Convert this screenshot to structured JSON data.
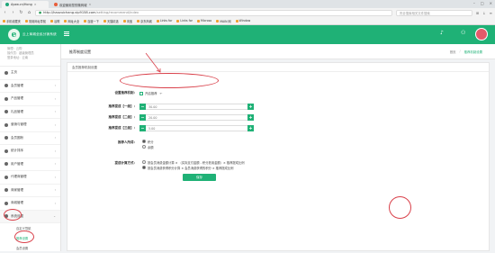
{
  "browser": {
    "tabs": [
      {
        "title": "Ayaw.cn/Hong",
        "active": true
      },
      {
        "title": "欢迎使用您的微商城",
        "active": false
      }
    ],
    "url_host": "http://haozuichang.vip9158.com",
    "url_path": "/setting/recommend/index",
    "search_placeholder": "完全搜索相关文件搜索",
    "bookmarks": [
      "手机收藏夹",
      "常用网址导航",
      "谷歌",
      "网址大全",
      "百度一下",
      "天猫精选",
      "淘宝",
      "京东商城",
      "Links for",
      "Links for",
      "Microso",
      "MAIN 网",
      "Window"
    ]
  },
  "app": {
    "brand": "云上商城全民分销系统",
    "logo_letter": "e"
  },
  "sidebar": {
    "info": [
      "管理：云购",
      "操作员：超级管理员",
      "登录地址：云南"
    ],
    "items": [
      {
        "label": "主页",
        "chevron": ""
      },
      {
        "label": "会员管理",
        "chevron": "‹"
      },
      {
        "label": "产品管理",
        "chevron": "‹"
      },
      {
        "label": "礼品管理",
        "chevron": "‹"
      },
      {
        "label": "营销与管理",
        "chevron": "‹"
      },
      {
        "label": "会员圈粉",
        "chevron": "‹"
      },
      {
        "label": "统计排序",
        "chevron": "‹"
      },
      {
        "label": "用户管理",
        "chevron": "‹"
      },
      {
        "label": "代理商管理",
        "chevron": "‹"
      },
      {
        "label": "商家管理",
        "chevron": "‹"
      },
      {
        "label": "商城管理",
        "chevron": "‹"
      },
      {
        "label": "系统设置",
        "chevron": "⌄"
      }
    ],
    "subitems": [
      "自定义导航",
      "推荐设置",
      "会员设置"
    ]
  },
  "page": {
    "title": "推荐制度设置",
    "crumbs": [
      "首页",
      "推荐机制设置"
    ],
    "panel_title": "会员推荐机制设置"
  },
  "form": {
    "switch_label": "设置推荐机制：",
    "switch_option": "开启推荐",
    "level1_label": "推荐提成【一级】：",
    "level1_value": "30.00",
    "level2_label": "推荐提成【二级】：",
    "level2_value": "20.00",
    "level3_label": "推荐提成【三级】：",
    "level3_value": "5.00",
    "minus": "−",
    "plus": "+",
    "recipient_label": "推荐人所得：",
    "recipient_options": [
      "积分",
      "余额"
    ],
    "recipient_selected": 0,
    "calc_label": "提成计算方式：",
    "calc_options": [
      "按会员消费金额计算 × （实际支付金额 - 积分抵用金额）× 推荐提成比例",
      "按会员消费获得积分计算 × 会员消费获得的积分 × 推荐提成比例"
    ],
    "calc_selected": 1,
    "save_label": "保存"
  },
  "annotation_color": "#d9404a"
}
